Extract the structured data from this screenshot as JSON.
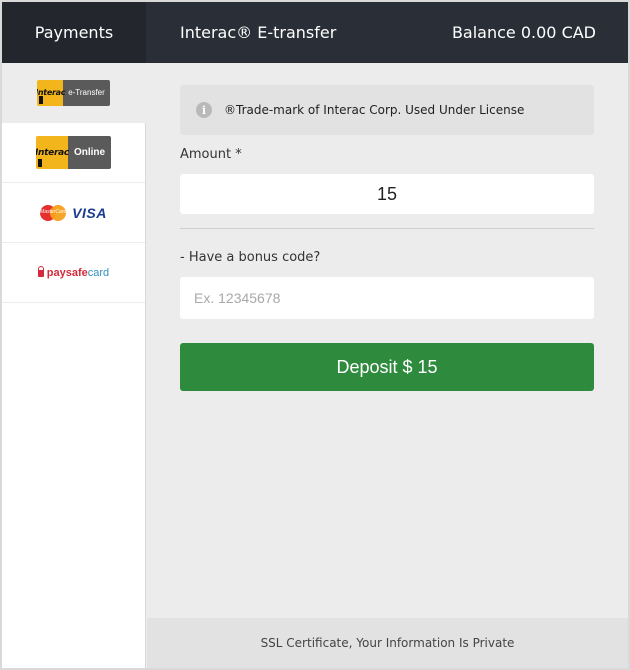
{
  "header": {
    "payments_label": "Payments",
    "title": "Interac® E-transfer",
    "balance": "Balance 0.00 CAD"
  },
  "sidebar": {
    "methods": [
      {
        "id": "interac-etransfer",
        "badge": "Interac",
        "side_text": "e-Transfer",
        "active": true
      },
      {
        "id": "interac-online",
        "badge": "Interac",
        "side_text": "Online",
        "active": false
      },
      {
        "id": "mastercard-visa",
        "mc_text": "MasterCard",
        "visa_text": "VISA",
        "active": false
      },
      {
        "id": "paysafecard",
        "text_part1": "paysafe",
        "text_part2": "card",
        "active": false
      }
    ]
  },
  "main": {
    "notice_icon": "i",
    "notice": "®Trade-mark of Interac Corp. Used Under License",
    "amount_label": "Amount *",
    "amount_value": "15",
    "bonus_label": "- Have a bonus code?",
    "bonus_placeholder": "Ex. 12345678",
    "deposit_label": "Deposit $ 15"
  },
  "footer": {
    "text": "SSL Certificate, Your Information Is Private"
  },
  "colors": {
    "header_bg": "#2a2e36",
    "deposit_green": "#2e8b3e",
    "interac_yellow": "#f2b51c"
  }
}
